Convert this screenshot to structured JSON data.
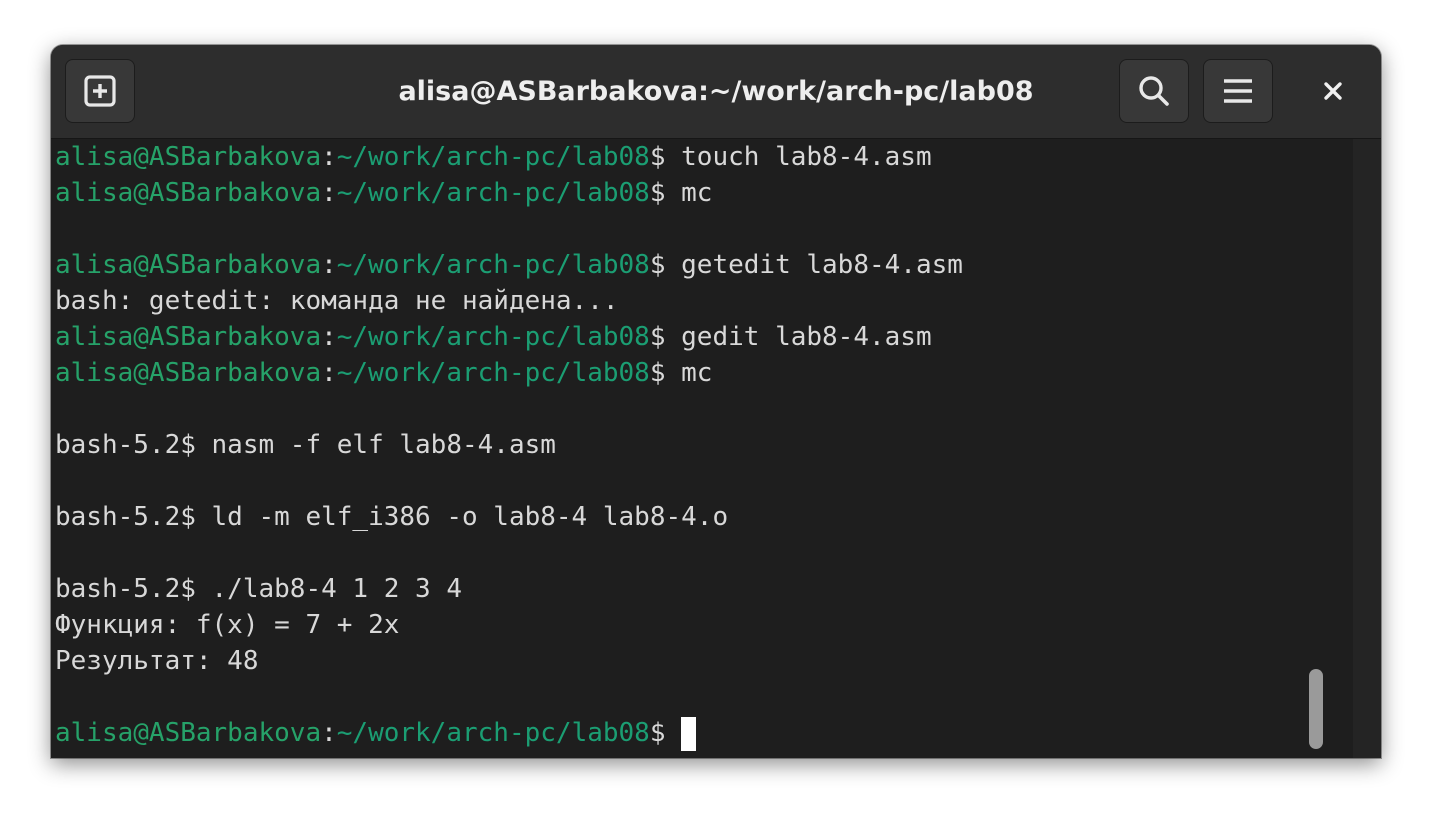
{
  "window": {
    "title": "alisa@ASBarbakova:~/work/arch-pc/lab08"
  },
  "titlebar": {
    "new_tab_icon": "new-tab-icon",
    "search_icon": "search-icon",
    "menu_icon": "hamburger-menu-icon",
    "close_icon": "close-icon"
  },
  "terminal": {
    "prompt_user": "alisa@ASBarbakova",
    "prompt_colon": ":",
    "prompt_path": "~/work/arch-pc/lab08",
    "lines": [
      {
        "type": "prompt",
        "cmd": "$ touch lab8-4.asm"
      },
      {
        "type": "prompt",
        "cmd": "$ mc"
      },
      {
        "type": "text",
        "text": ""
      },
      {
        "type": "prompt",
        "cmd": "$ getedit lab8-4.asm"
      },
      {
        "type": "text",
        "text": "bash: getedit: команда не найдена..."
      },
      {
        "type": "prompt",
        "cmd": "$ gedit lab8-4.asm"
      },
      {
        "type": "prompt",
        "cmd": "$ mc"
      },
      {
        "type": "text",
        "text": ""
      },
      {
        "type": "text",
        "text": "bash-5.2$ nasm -f elf lab8-4.asm"
      },
      {
        "type": "text",
        "text": ""
      },
      {
        "type": "text",
        "text": "bash-5.2$ ld -m elf_i386 -o lab8-4 lab8-4.o"
      },
      {
        "type": "text",
        "text": ""
      },
      {
        "type": "text",
        "text": "bash-5.2$ ./lab8-4 1 2 3 4"
      },
      {
        "type": "text",
        "text": "Функция: f(x) = 7 + 2x"
      },
      {
        "type": "text",
        "text": "Результат: 48"
      },
      {
        "type": "text",
        "text": ""
      },
      {
        "type": "prompt",
        "cmd": "$ "
      }
    ]
  },
  "colors": {
    "background": "#1e1e1e",
    "titlebar": "#2d2d2d",
    "prompt_green": "#26a269",
    "text": "#d8d8d8"
  }
}
